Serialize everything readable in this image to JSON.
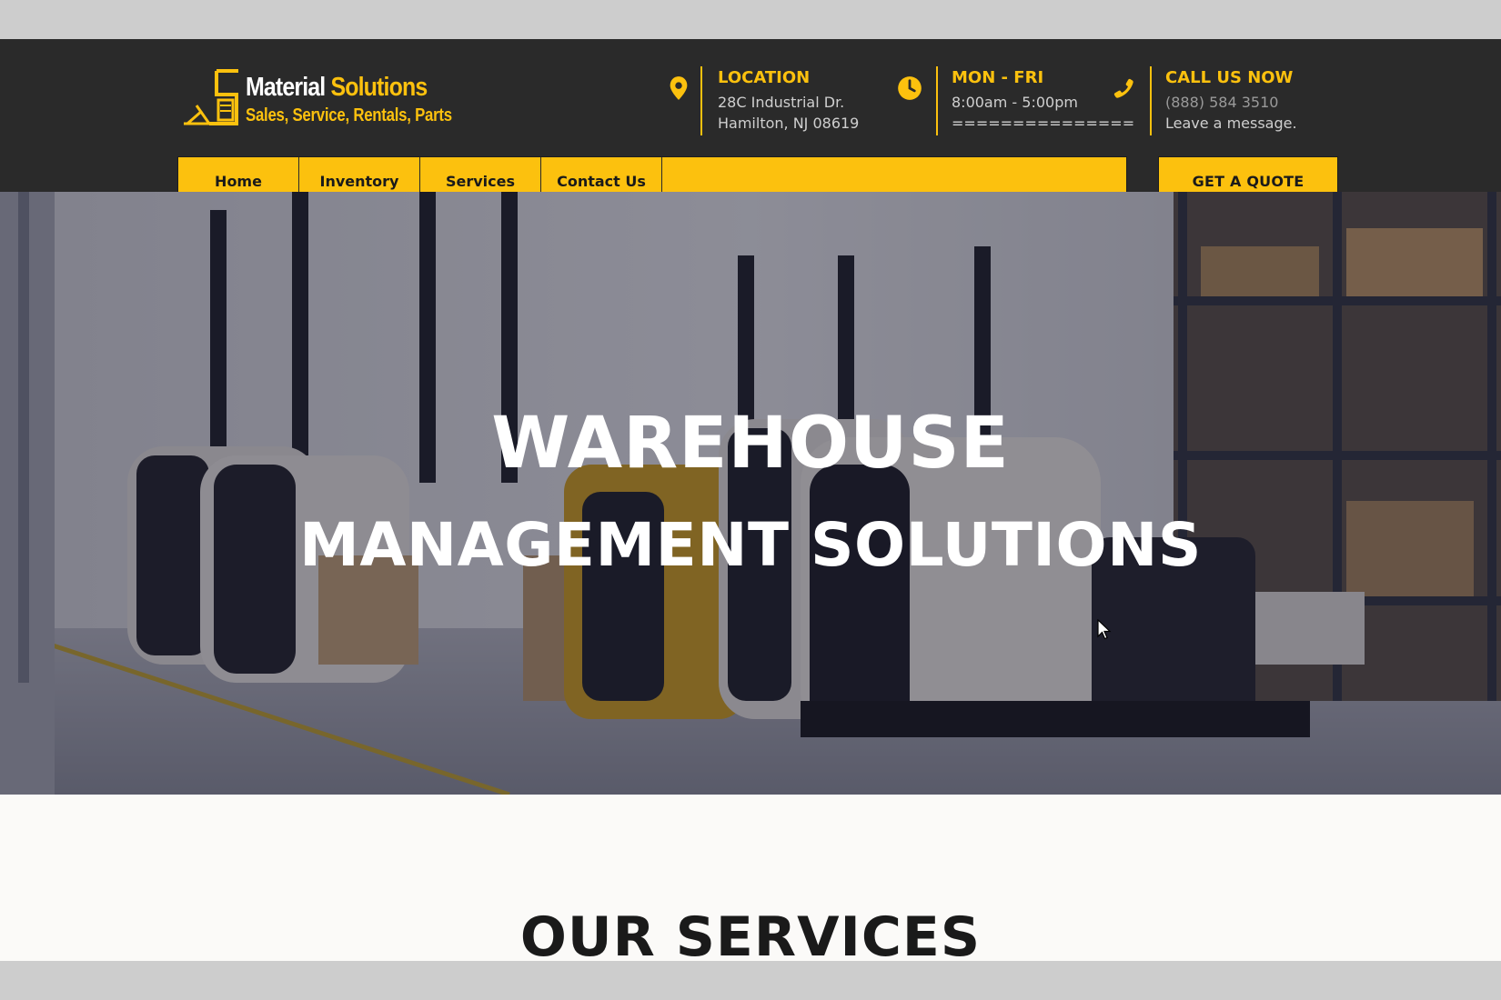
{
  "brand": {
    "name_part1": "Material",
    "name_part2": "Solutions",
    "tagline": "Sales, Service, Rentals, Parts"
  },
  "contact": {
    "location": {
      "title": "LOCATION",
      "line1": "28C Industrial Dr.",
      "line2": "Hamilton, NJ 08619",
      "icon": "map-pin-icon"
    },
    "hours": {
      "title": "MON - FRI",
      "line1": "8:00am - 5:00pm",
      "line2": "===============",
      "icon": "clock-icon"
    },
    "phone": {
      "title": "CALL US NOW",
      "line1": "(888) 584 3510",
      "line2": "Leave a message.",
      "icon": "phone-icon"
    }
  },
  "nav": {
    "items": [
      {
        "label": "Home"
      },
      {
        "label": "Inventory"
      },
      {
        "label": "Services"
      },
      {
        "label": "Contact Us"
      }
    ],
    "quote_label": "GET A QUOTE"
  },
  "hero": {
    "title_line1": "WAREHOUSE",
    "title_line2": "MANAGEMENT SOLUTIONS"
  },
  "services": {
    "title": "OUR SERVICES"
  },
  "colors": {
    "accent": "#fcc10e",
    "header_bg": "#2a2a2a",
    "page_bg": "#fbfaf8"
  }
}
